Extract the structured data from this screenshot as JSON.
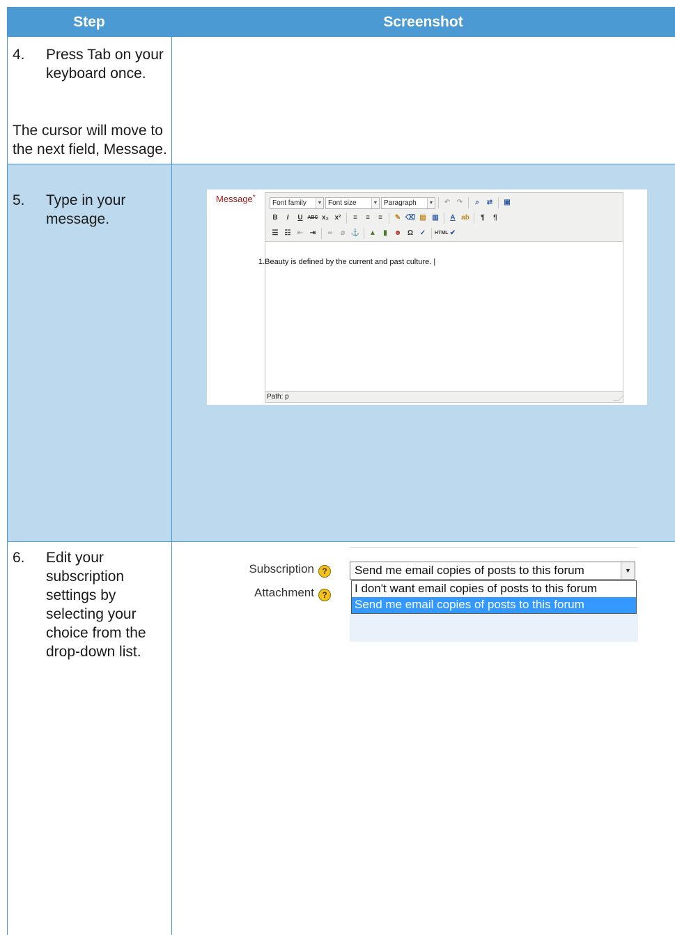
{
  "header": {
    "step": "Step",
    "screenshot": "Screenshot"
  },
  "steps": [
    {
      "number": "4.",
      "text": "Press Tab on your keyboard once.",
      "note": "The cursor will move to the next field, Message."
    },
    {
      "number": "5.",
      "text": "Type in your message."
    },
    {
      "number": "6.",
      "text": "Edit your subscription settings by selecting your choice from the drop-down list."
    }
  ],
  "editor": {
    "label": "Message",
    "required_mark": "*",
    "font_family": "Font family",
    "font_size": "Font size",
    "format": "Paragraph",
    "content": "1.Beauty is defined by the current and past culture. |",
    "path": "Path: p"
  },
  "subscription": {
    "label": "Subscription",
    "attachment_label": "Attachment",
    "help_glyph": "?",
    "selected": "Send me email copies of posts to this forum",
    "options": [
      "I don't want email copies of posts to this forum",
      "Send me email copies of posts to this forum"
    ]
  }
}
